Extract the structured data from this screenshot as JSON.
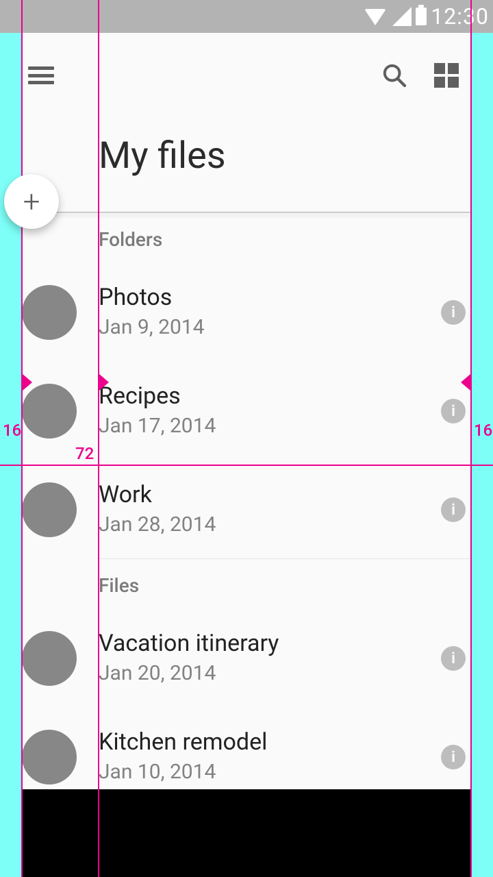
{
  "statusbar": {
    "time": "12:30"
  },
  "page": {
    "title": "My files"
  },
  "sections": {
    "folders_header": "Folders",
    "files_header": "Files"
  },
  "folders": [
    {
      "name": "Photos",
      "date": "Jan 9, 2014"
    },
    {
      "name": "Recipes",
      "date": "Jan 17, 2014"
    },
    {
      "name": "Work",
      "date": "Jan 28, 2014"
    }
  ],
  "files": [
    {
      "name": "Vacation itinerary",
      "date": "Jan 20, 2014"
    },
    {
      "name": "Kitchen remodel",
      "date": "Jan 10, 2014"
    }
  ],
  "keylines": {
    "left_margin": "16",
    "content_left": "72",
    "right_margin": "16"
  }
}
